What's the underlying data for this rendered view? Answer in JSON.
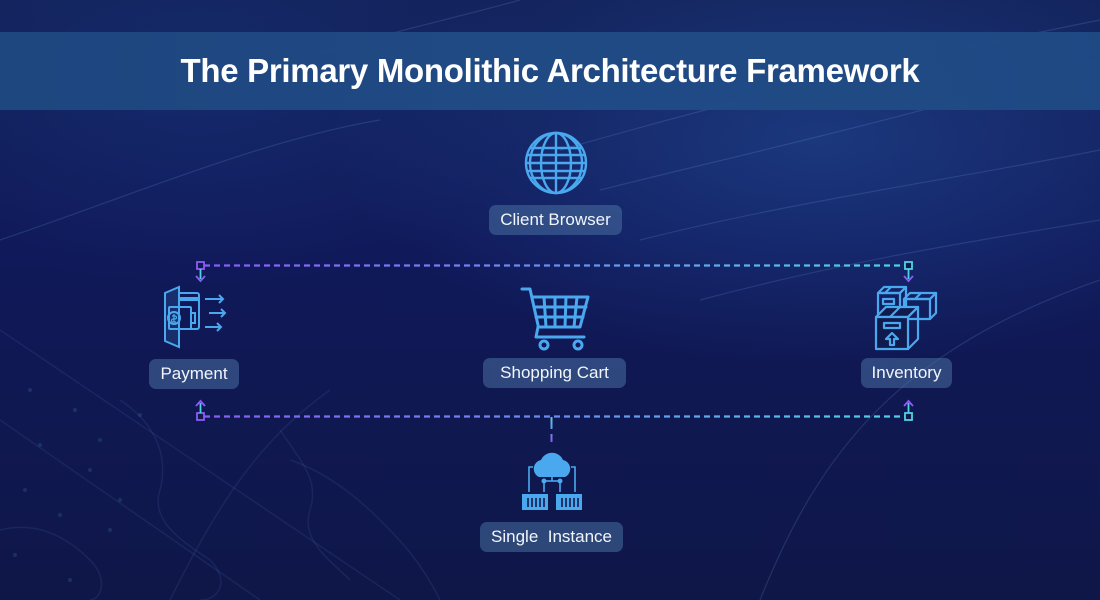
{
  "header": {
    "title": "The Primary Monolithic Architecture Framework"
  },
  "nodes": {
    "client_browser": {
      "label": "Client Browser",
      "icon": "globe-icon"
    },
    "payment": {
      "label": "Payment",
      "icon": "wallet-payment-icon"
    },
    "shopping_cart": {
      "label": "Shopping Cart",
      "icon": "shopping-cart-icon"
    },
    "inventory": {
      "label": "Inventory",
      "icon": "boxes-icon"
    },
    "single_instance": {
      "label": "Single  Instance",
      "icon": "cloud-server-icon"
    }
  },
  "colors": {
    "background": "#101a4c",
    "header_band": "#1f4a84",
    "title_text": "#ffffff",
    "icon_stroke": "#4aa8ee",
    "label_pill": "#3a5f90",
    "connector_left": "#8a5cf5",
    "connector_right": "#4fd3e0"
  }
}
